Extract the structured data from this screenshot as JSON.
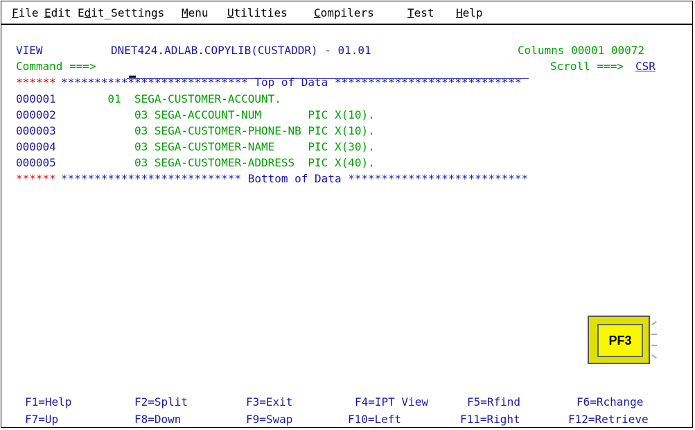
{
  "menubar": {
    "items": [
      {
        "pre": "",
        "ul": "F",
        "post": "ile"
      },
      {
        "pre": "",
        "ul": "E",
        "post": "dit"
      },
      {
        "pre": "E",
        "ul": "d",
        "post": "it_Settings"
      },
      {
        "pre": "",
        "ul": "M",
        "post": "enu"
      },
      {
        "pre": "",
        "ul": "U",
        "post": "tilities"
      },
      {
        "pre": "",
        "ul": "C",
        "post": "ompilers"
      },
      {
        "pre": "",
        "ul": "T",
        "post": "est"
      },
      {
        "pre": "",
        "ul": "H",
        "post": "elp"
      }
    ]
  },
  "header": {
    "mode": "VIEW",
    "dataset": "DNET424.ADLAB.COPYLIB(CUSTADDR) - 01.01",
    "columns": "Columns 00001 00072",
    "command_label": "Command ===>",
    "command_value": "",
    "scroll_label": "Scroll ===>",
    "scroll_value": "CSR"
  },
  "editor": {
    "top_marker_prefix": "******",
    "top_marker": "**************************** Top of Data ****************************",
    "bottom_marker_prefix": "******",
    "bottom_marker": "*************************** Bottom of Data ***************************",
    "lines": [
      {
        "num": "000001",
        "text": "       01  SEGA-CUSTOMER-ACCOUNT."
      },
      {
        "num": "000002",
        "text": "           03 SEGA-ACCOUNT-NUM       PIC X(10)."
      },
      {
        "num": "000003",
        "text": "           03 SEGA-CUSTOMER-PHONE-NB PIC X(10)."
      },
      {
        "num": "000004",
        "text": "           03 SEGA-CUSTOMER-NAME     PIC X(30)."
      },
      {
        "num": "000005",
        "text": "           03 SEGA-CUSTOMER-ADDRESS  PIC X(40)."
      }
    ]
  },
  "fkeys": {
    "row1": [
      "F1=Help",
      "F2=Split",
      "F3=Exit",
      "F4=IPT View",
      "F5=Rfind",
      "F6=Rchange"
    ],
    "row2": [
      "F7=Up",
      "F8=Down",
      "F9=Swap",
      "F10=Left",
      "F11=Right",
      "F12=Retrieve"
    ]
  },
  "callout": {
    "label": "PF3"
  },
  "colors": {
    "blue": "#1a1aa8",
    "green": "#00a000",
    "red": "#e00000",
    "key_yellow": "#f8f800"
  }
}
